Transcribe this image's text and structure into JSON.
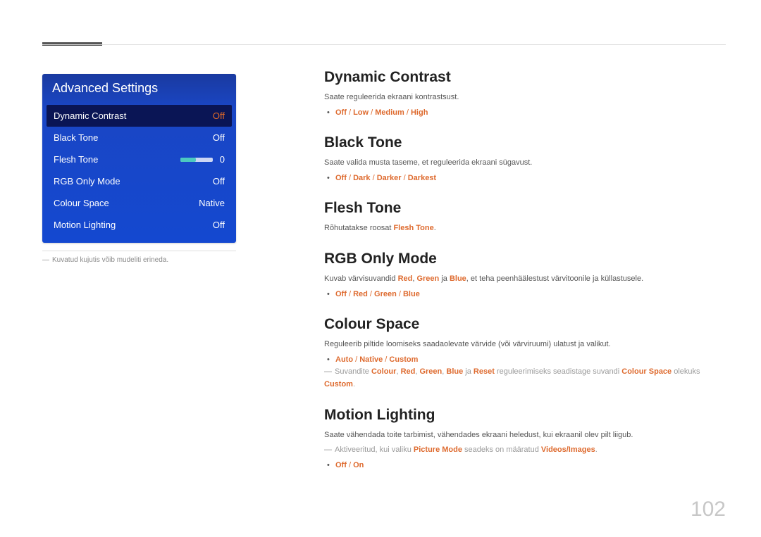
{
  "page_number": "102",
  "panel": {
    "title": "Advanced Settings",
    "rows": [
      {
        "label": "Dynamic Contrast",
        "value": "Off",
        "selected": true,
        "slider": false
      },
      {
        "label": "Black Tone",
        "value": "Off",
        "selected": false,
        "slider": false
      },
      {
        "label": "Flesh Tone",
        "value": "0",
        "selected": false,
        "slider": true
      },
      {
        "label": "RGB Only Mode",
        "value": "Off",
        "selected": false,
        "slider": false
      },
      {
        "label": "Colour Space",
        "value": "Native",
        "selected": false,
        "slider": false
      },
      {
        "label": "Motion Lighting",
        "value": "Off",
        "selected": false,
        "slider": false
      }
    ]
  },
  "left_note": "Kuvatud kujutis võib mudeliti erineda.",
  "sections": {
    "dynamic_contrast": {
      "heading": "Dynamic Contrast",
      "desc": "Saate reguleerida ekraani kontrastsust.",
      "options": [
        "Off",
        "Low",
        "Medium",
        "High"
      ]
    },
    "black_tone": {
      "heading": "Black Tone",
      "desc": "Saate valida musta taseme, et reguleerida ekraani sügavust.",
      "options": [
        "Off",
        "Dark",
        "Darker",
        "Darkest"
      ]
    },
    "flesh_tone": {
      "heading": "Flesh Tone",
      "desc_prefix": "Rõhutatakse roosat ",
      "desc_hl": "Flesh Tone",
      "desc_suffix": "."
    },
    "rgb_only": {
      "heading": "RGB Only Mode",
      "desc_prefix": "Kuvab värvisuvandid ",
      "red": "Red",
      "green": "Green",
      "blue": "Blue",
      "comma": ", ",
      "ja": " ja ",
      "desc_suffix": ", et teha peenhäälestust värvitoonile ja küllastusele.",
      "options": [
        "Off",
        "Red",
        "Green",
        "Blue"
      ]
    },
    "colour_space": {
      "heading": "Colour Space",
      "desc": "Reguleerib piltide loomiseks saadaolevate värvide (või värviruumi) ulatust ja valikut.",
      "options": [
        "Auto",
        "Native",
        "Custom"
      ],
      "note_prefix": "Suvandite ",
      "colour": "Colour",
      "red": "Red",
      "green": "Green",
      "blue": "Blue",
      "reset": "Reset",
      "comma": ", ",
      "ja": " ja ",
      "note_mid": " reguleerimiseks seadistage suvandi ",
      "cs": "Colour Space",
      "note_mid2": " olekuks ",
      "custom": "Custom",
      "note_end": "."
    },
    "motion_lighting": {
      "heading": "Motion Lighting",
      "desc": "Saate vähendada toite tarbimist, vähendades ekraani heledust, kui ekraanil olev pilt liigub.",
      "note_prefix": "Aktiveeritud, kui valiku ",
      "pm": "Picture Mode",
      "note_mid": " seadeks on määratud ",
      "vi": "Videos/Images",
      "note_end": ".",
      "options": [
        "Off",
        "On"
      ]
    }
  }
}
